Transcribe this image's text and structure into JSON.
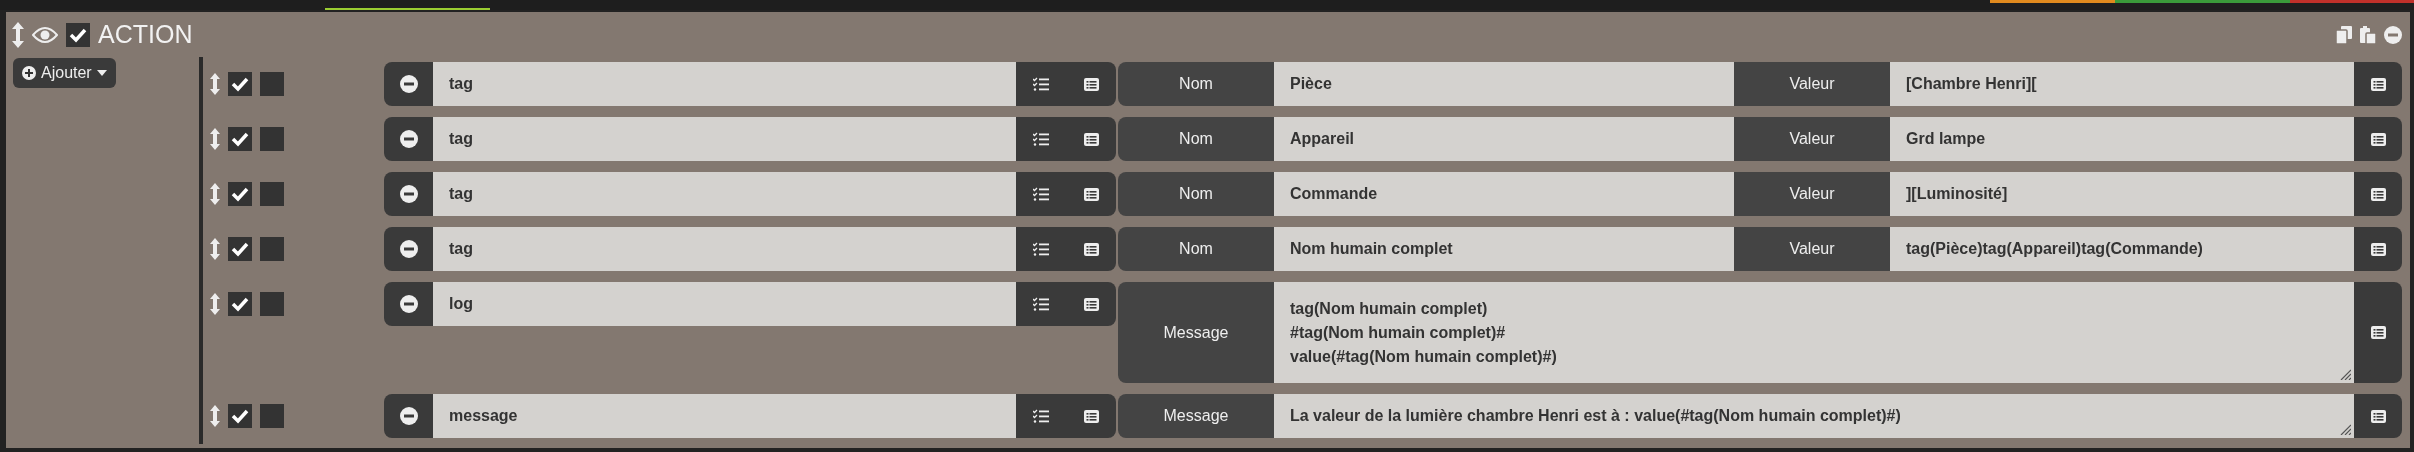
{
  "header": {
    "title": "ACTION",
    "enabled": true
  },
  "add_button": "Ajouter",
  "actions": [
    {
      "kind": "tag",
      "enabled": true,
      "parallel": false,
      "expression": "tag",
      "name_label": "Nom",
      "name": "Pièce",
      "value_label": "Valeur",
      "value": "[Chambre Henri]["
    },
    {
      "kind": "tag",
      "enabled": true,
      "parallel": false,
      "expression": "tag",
      "name_label": "Nom",
      "name": "Appareil",
      "value_label": "Valeur",
      "value": "Grd lampe"
    },
    {
      "kind": "tag",
      "enabled": true,
      "parallel": false,
      "expression": "tag",
      "name_label": "Nom",
      "name": "Commande",
      "value_label": "Valeur",
      "value": "][Luminosité]"
    },
    {
      "kind": "tag",
      "enabled": true,
      "parallel": false,
      "expression": "tag",
      "name_label": "Nom",
      "name": "Nom humain complet",
      "value_label": "Valeur",
      "value": "tag(Pièce)tag(Appareil)tag(Commande)"
    },
    {
      "kind": "message",
      "enabled": true,
      "parallel": false,
      "expression": "log",
      "label": "Message",
      "lines": [
        "tag(Nom humain complet)",
        "#tag(Nom humain complet)#",
        "value(#tag(Nom humain complet)#)"
      ]
    },
    {
      "kind": "message",
      "enabled": true,
      "parallel": false,
      "expression": "message",
      "label": "Message",
      "lines": [
        "La valeur de la lumière chambre Henri est à : value(#tag(Nom humain complet)#)"
      ]
    }
  ]
}
